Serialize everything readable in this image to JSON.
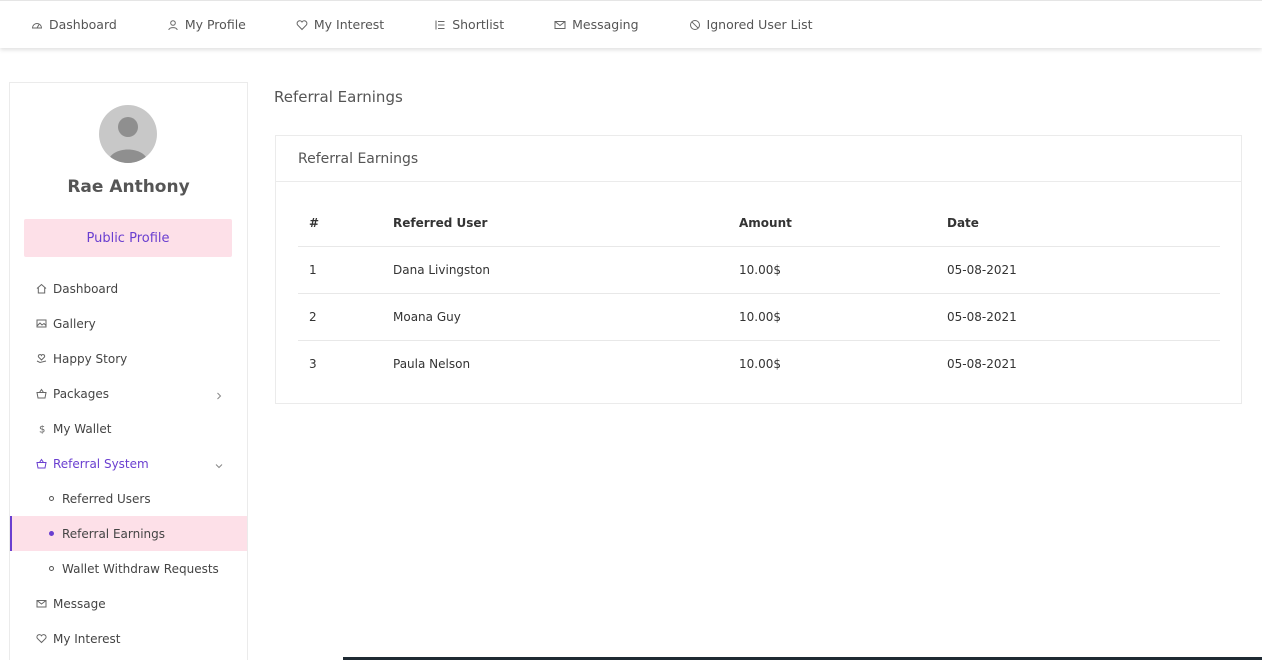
{
  "topnav": {
    "items": [
      {
        "label": "Dashboard",
        "icon": "dashboard-icon"
      },
      {
        "label": "My Profile",
        "icon": "user-icon"
      },
      {
        "label": "My Interest",
        "icon": "heart-icon"
      },
      {
        "label": "Shortlist",
        "icon": "list-icon"
      },
      {
        "label": "Messaging",
        "icon": "mail-icon"
      },
      {
        "label": "Ignored User List",
        "icon": "block-icon"
      }
    ]
  },
  "sidebar": {
    "user_name": "Rae Anthony",
    "public_profile_label": "Public Profile",
    "menu": [
      {
        "label": "Dashboard",
        "icon": "home-icon"
      },
      {
        "label": "Gallery",
        "icon": "image-icon"
      },
      {
        "label": "Happy Story",
        "icon": "heart-hand-icon"
      },
      {
        "label": "Packages",
        "icon": "basket-icon"
      },
      {
        "label": "My Wallet",
        "icon": "dollar-icon"
      },
      {
        "label": "Referral System",
        "icon": "basket-icon"
      },
      {
        "label": "Message",
        "icon": "mail-icon"
      },
      {
        "label": "My Interest",
        "icon": "heart-icon"
      }
    ],
    "referral_sub": [
      {
        "label": "Referred Users"
      },
      {
        "label": "Referral Earnings"
      },
      {
        "label": "Wallet Withdraw Requests"
      }
    ]
  },
  "main": {
    "page_title": "Referral Earnings",
    "card_title": "Referral Earnings",
    "columns": [
      "#",
      "Referred User",
      "Amount",
      "Date"
    ],
    "rows": [
      [
        "1",
        "Dana Livingston",
        "10.00$",
        "05-08-2021"
      ],
      [
        "2",
        "Moana Guy",
        "10.00$",
        "05-08-2021"
      ],
      [
        "3",
        "Paula Nelson",
        "10.00$",
        "05-08-2021"
      ]
    ]
  },
  "colors": {
    "accent": "#6a3fd0",
    "highlight_bg": "#fde0e8"
  }
}
